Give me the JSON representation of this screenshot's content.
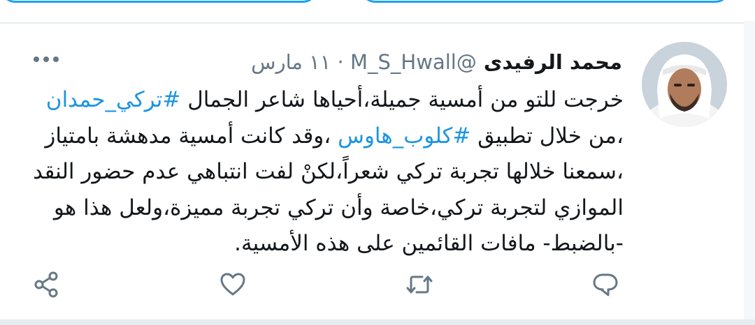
{
  "tweet": {
    "author_name": "محمد الرفيدى",
    "handle": "@M_S_Hwall",
    "separator": "·",
    "date": "١١ مارس",
    "lines": [
      {
        "pre": "خرجت للتو من أمسية جميلة،أحياها شاعر الجمال ",
        "tag": "#تركي_حمدان",
        "post": ""
      },
      {
        "pre": "،من خلال تطبيق ",
        "tag": "#كلوب_هاوس",
        "post": " ،وقد كانت أمسية مدهشة بامتياز"
      },
      {
        "pre": "،سمعنا خلالها تجربة تركي شعراً،لكنْ لفت انتباهي عدم حضور النقد",
        "tag": "",
        "post": ""
      },
      {
        "pre": "الموازي لتجربة تركي،خاصة وأن تركي تجربة مميزة،ولعل هذا هو",
        "tag": "",
        "post": ""
      },
      {
        "pre": "-بالضبط- مافات القائمين على هذه الأمسية.",
        "tag": "",
        "post": ""
      }
    ]
  },
  "actions": [
    {
      "icon": "share-icon"
    },
    {
      "icon": "heart-icon"
    },
    {
      "icon": "retweet-icon"
    },
    {
      "icon": "reply-icon"
    }
  ],
  "colors": {
    "accent": "#1da1f2",
    "hashtag": "#1b95e0",
    "text": "#14171a",
    "muted": "#657786",
    "icon": "#657786",
    "divider": "#e6ecf0"
  }
}
